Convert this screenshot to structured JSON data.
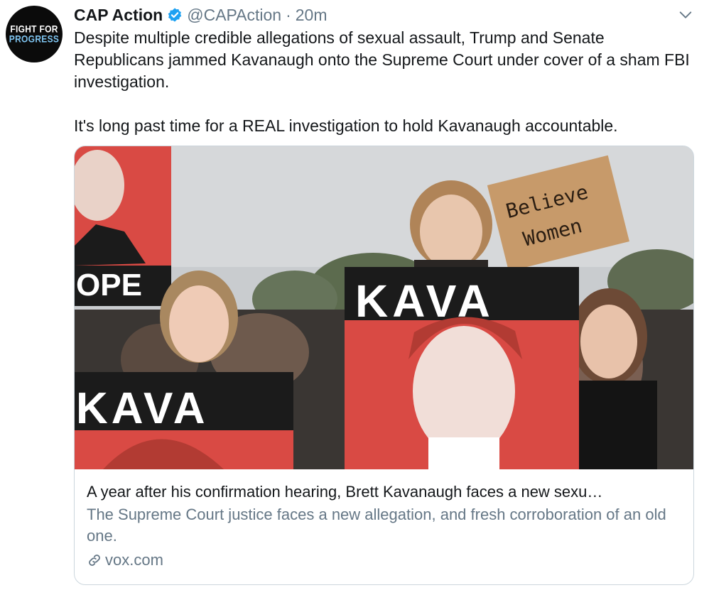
{
  "tweet": {
    "avatar": {
      "line1": "FIGHT FOR",
      "line2": "PROGRESS"
    },
    "author_name": "CAP Action",
    "handle": "@CAPAction",
    "separator": "·",
    "time": "20m",
    "paragraphs": [
      "Despite multiple credible allegations of sexual assault, Trump and Senate Republicans jammed Kavanaugh onto the Supreme Court under cover of a sham FBI investigation.",
      "It's long past time for a REAL investigation to hold Kavanaugh accountable."
    ],
    "card": {
      "image_texts": {
        "sign_believe_1": "Believe",
        "sign_believe_2": "Women",
        "poster_center": "KAVA",
        "poster_left": "KAVA",
        "poster_top_left": "OPE"
      },
      "title": "A year after his confirmation hearing, Brett Kavanaugh faces a new sexu…",
      "description": "The Supreme Court justice faces a new allegation, and fresh corroboration of an old one.",
      "domain": "vox.com"
    },
    "colors": {
      "text": "#14171a",
      "secondary": "#657786",
      "verified": "#1da1f2",
      "border": "#ccd6dd",
      "poster_red": "#d94a44"
    }
  }
}
